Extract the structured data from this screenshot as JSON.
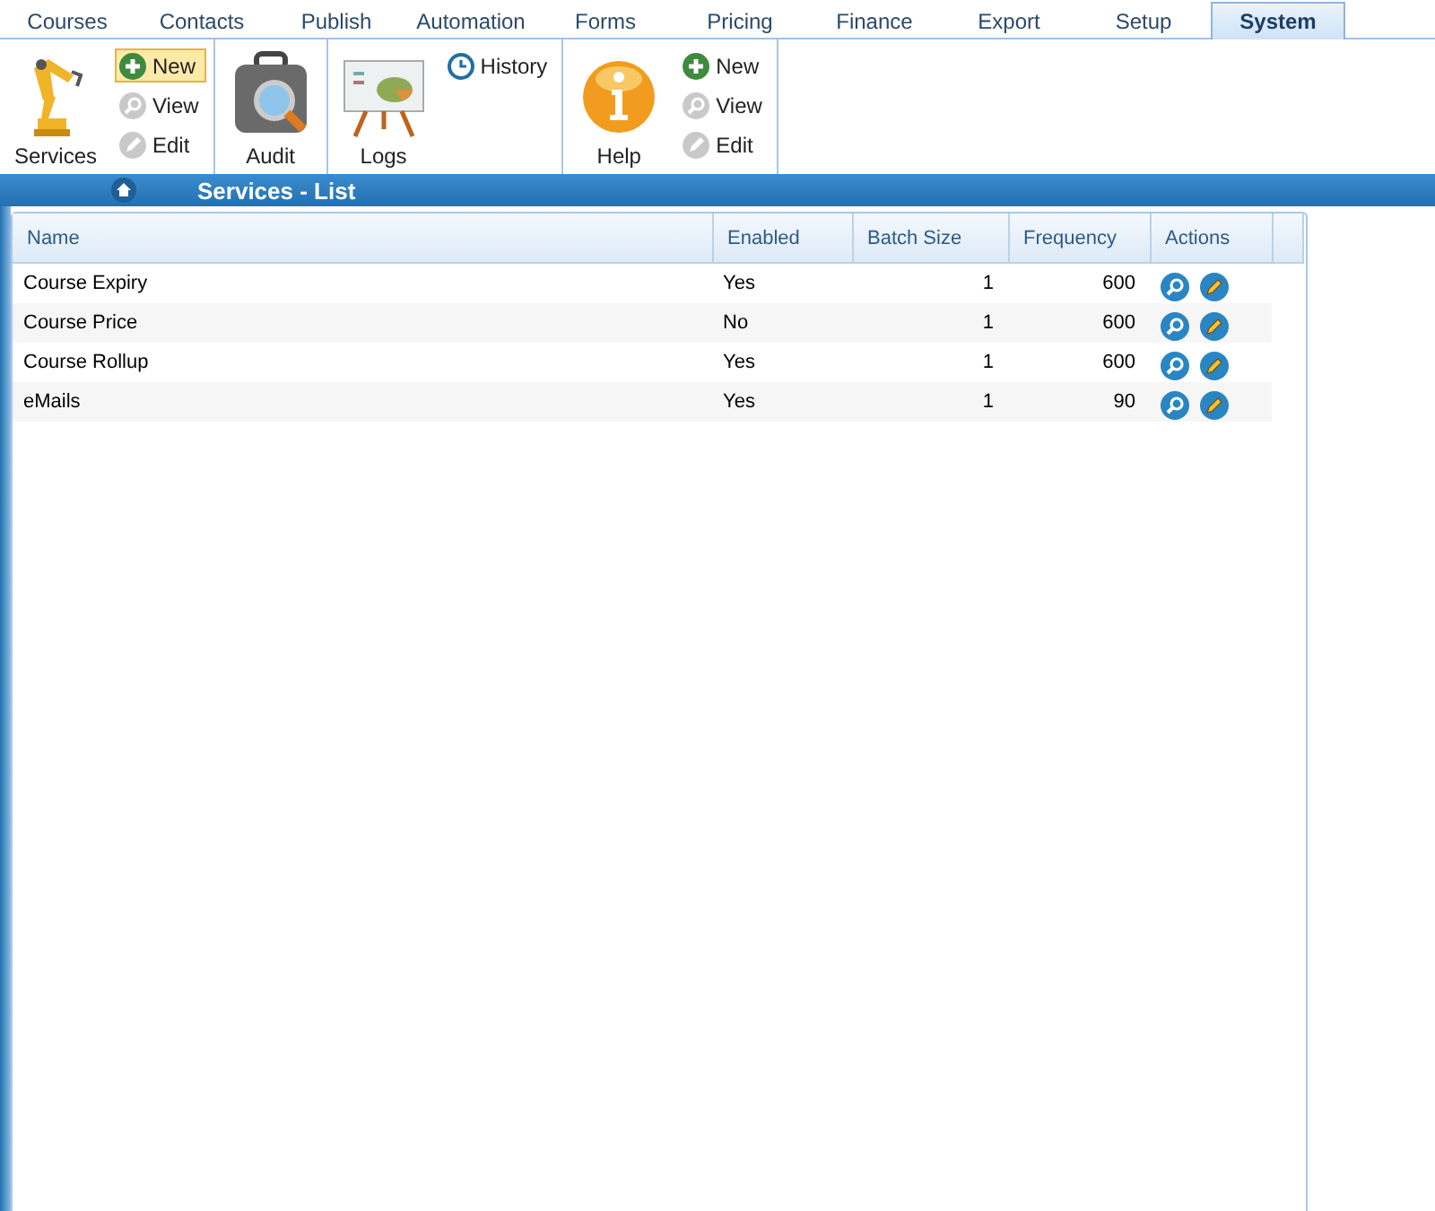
{
  "tabs": [
    {
      "label": "Courses",
      "selected": false
    },
    {
      "label": "Contacts",
      "selected": false
    },
    {
      "label": "Publish",
      "selected": false
    },
    {
      "label": "Automation",
      "selected": false
    },
    {
      "label": "Forms",
      "selected": false
    },
    {
      "label": "Pricing",
      "selected": false
    },
    {
      "label": "Finance",
      "selected": false
    },
    {
      "label": "Export",
      "selected": false
    },
    {
      "label": "Setup",
      "selected": false
    },
    {
      "label": "System",
      "selected": true
    }
  ],
  "ribbon": [
    {
      "big": {
        "label": "Services",
        "kind": "robot"
      },
      "small": [
        {
          "label": "New",
          "kind": "plus",
          "highlighted": true
        },
        {
          "label": "View",
          "kind": "view",
          "highlighted": false
        },
        {
          "label": "Edit",
          "kind": "edit",
          "highlighted": false
        }
      ]
    },
    {
      "big": {
        "label": "Audit",
        "kind": "audit"
      }
    },
    {
      "big": {
        "label": "Logs",
        "kind": "logs"
      },
      "small": [
        {
          "label": "History",
          "kind": "clock",
          "highlighted": false
        }
      ]
    },
    {
      "big": {
        "label": "Help",
        "kind": "help"
      },
      "small": [
        {
          "label": "New",
          "kind": "plus",
          "highlighted": false
        },
        {
          "label": "View",
          "kind": "view",
          "highlighted": false
        },
        {
          "label": "Edit",
          "kind": "edit",
          "highlighted": false
        }
      ]
    }
  ],
  "header": {
    "title": "Services - List"
  },
  "table": {
    "columns": [
      "Name",
      "Enabled",
      "Batch Size",
      "Frequency",
      "Actions"
    ],
    "rows": [
      {
        "name": "Course Expiry",
        "enabled": "Yes",
        "batch_size": "1",
        "frequency": "600"
      },
      {
        "name": "Course Price",
        "enabled": "No",
        "batch_size": "1",
        "frequency": "600"
      },
      {
        "name": "Course Rollup",
        "enabled": "Yes",
        "batch_size": "1",
        "frequency": "600"
      },
      {
        "name": "eMails",
        "enabled": "Yes",
        "batch_size": "1",
        "frequency": "90"
      }
    ]
  }
}
